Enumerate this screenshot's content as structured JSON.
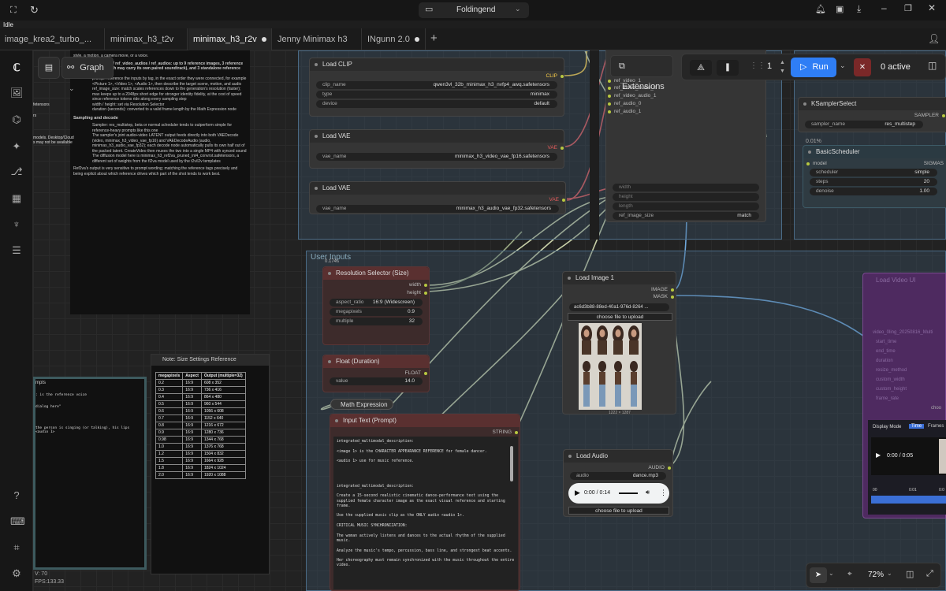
{
  "window": {
    "title": "Foldingend",
    "status": "Idle"
  },
  "tabs": [
    {
      "label": "image_krea2_turbo_..."
    },
    {
      "label": "minimax_h3_t2v"
    },
    {
      "label": "minimax_h3_r2v"
    },
    {
      "label": "Jenny Minimax h3"
    },
    {
      "label": "INgunn 2.0"
    }
  ],
  "toolbar": {
    "graph_label": "Graph",
    "extensions_label": "Extensions",
    "queue_count": "1",
    "run_label": "Run",
    "active_label": "0 active"
  },
  "bottom_right": {
    "zoom": "72%"
  },
  "stats": {
    "v": "V: 70",
    "fps": "FPS:133.33"
  },
  "doc": {
    "header": "About this workflow",
    "intro": "style, a motion, a camera move, or a voice.",
    "lines": [
      "ref_videos / ref_video_audios / ref_audios: up to 9 reference images, 3 reference videos (each may carry its own paired soundtrack), and 3 standalone reference audio clips",
      "prompt: reference the inputs by tag, in the exact order they were connected, for example <Picture 1>, <Video 1>, <Audio 1>, then describe the target scene, motion, and audio",
      "ref_image_size: match scales references down to the generation's resolution (faster); max keeps up to a 2048px short edge for stronger identity fidelity, at the cost of speed since reference tokens ride along every sampling step",
      "width / height: set via Resolution Selector",
      "duration (seconds): converted to a valid frame length by the Math Expression node"
    ],
    "section": "Sampling and decode",
    "sampling": [
      "Sampler: res_multistep, beta or normal scheduler tends to outperform simple for reference-heavy prompts like this one",
      "The sampler's joint audio+video LATENT output feeds directly into both VAEDecode (video, minimax_h3_video_vae_fp16) and VAEDecodeAudio (audio, minimax_h3_audio_vae_fp32); each decode node automatically pulls its own half out of the packed latent. CreateVideo then muxes the two into a single MP4 with synced sound",
      "The diffusion model here is minimax_h3_ref2va_pruned_int4_convrot.safetensors, a different set of weights from the fl2va model used by the t2v/i2v templates"
    ],
    "footer": "Ref2va's output is very sensitive to prompt wording; matching the reference tags precisely and being explicit about which reference drives which part of the shot tends to work best.",
    "side_frags": [
      "models. Desktop/Cloud",
      "s may not be available",
      "fetensors",
      "rs"
    ]
  },
  "mini_notes": {
    "title": "mpts",
    "lines": [
      ": is the reference voice",
      "dialog here\"",
      "the person is singing (or talking), his lips",
      "<audio 1>"
    ]
  },
  "nodes": {
    "load_clip": {
      "title": "Load CLIP",
      "out": "CLIP",
      "w": [
        [
          "clip_name",
          "qwen3vl_32b_minimax_h3_nvfp4_awq.safetensors"
        ],
        [
          "type",
          "minimax"
        ],
        [
          "device",
          "default"
        ]
      ]
    },
    "load_vae1": {
      "title": "Load VAE",
      "out": "VAE",
      "w": [
        [
          "vae_name",
          "minimax_h3_video_vae_fp16.safetensors"
        ]
      ]
    },
    "load_vae2": {
      "title": "Load VAE",
      "out": "VAE",
      "w": [
        [
          "vae_name",
          "minimax_h3_audio_vae_fp32.safetensors"
        ]
      ]
    },
    "refs": {
      "inputs": [
        "ref_video_1",
        "ref_video_audio_0",
        "ref_video_audio_1",
        "ref_audio_0",
        "ref_audio_1"
      ],
      "dim": [
        "width",
        "height",
        "length"
      ],
      "size": [
        "ref_image_size",
        "match"
      ]
    },
    "ksampler": {
      "title": "KSamplerSelect",
      "out": "SAMPLER",
      "w": [
        [
          "sampler_name",
          "res_multistep"
        ]
      ]
    },
    "percent": "0.01%",
    "scheduler": {
      "title": "BasicScheduler",
      "out": "SIGMAS",
      "in": "model",
      "w": [
        [
          "scheduler",
          "simple"
        ],
        [
          "steps",
          "20"
        ],
        [
          "denoise",
          "1.00"
        ]
      ]
    },
    "group_title": "User Inputs",
    "res": {
      "title": "Resolution Selector (Size)",
      "time": "0.174s",
      "outs": [
        "width",
        "height"
      ],
      "w": [
        [
          "aspect_ratio",
          "16:9 (Widescreen)"
        ],
        [
          "megapixels",
          "0.9"
        ],
        [
          "multiple",
          "32"
        ]
      ]
    },
    "float": {
      "title": "Float (Duration)",
      "out": "FLOAT",
      "w": [
        [
          "value",
          "14.0"
        ]
      ]
    },
    "math": {
      "title": "Math Expression"
    },
    "prompt": {
      "title": "Input Text (Prompt)",
      "out": "STRING",
      "text": "integrated_multimodal_description:\n\n<image 1> is the CHARACTER APPEARANCE REFERENCE for female dancer.\n\n<audio 1> use for music reference.\n\n\n\n\nintegrated_multimodal_description:\n\nCreate a 15-second realistic cinematic dance-performance text using the supplied female character image as the exact visual reference and starting frame.\n\nUse the supplied music clip as the ONLY audio <audio 1>.\n\nCRITICAL MUSIC SYNCHRONIZATION:\n\nThe woman actively listens and dances to the actual rhythm of the supplied music.\n\nAnalyze the music's tempo, percussion, bass line, and strongest beat accents.\n\nHer choreography must remain synchronized with the music throughout the entire video."
    },
    "load_image": {
      "title": "Load Image 1",
      "outs": [
        "IMAGE",
        "MASK"
      ],
      "file": "ac6d3b88-88ed-40a1-976d-8264 ...",
      "upload": "choose file to upload",
      "dims": "1222 × 1287"
    },
    "load_audio": {
      "title": "Load Audio",
      "out": "AUDIO",
      "file_label": "audio",
      "file": "dance.mp3",
      "time": "0:00 / 0:14",
      "upload": "choose file to upload"
    },
    "load_video": {
      "title": "Load Video UI",
      "ghost": [
        "video_0ling_20250816_Multi",
        "start_time",
        "end_time",
        "duration",
        "resize_method",
        "custom_width",
        "custom_height",
        "frame_rate"
      ],
      "choose": "choo",
      "display_mode": "Display Mode",
      "modes": [
        "Time",
        "Frames"
      ],
      "time": "0:00 / 0:05",
      "t0": "00",
      "t1": "0:01",
      "t2": "0:0"
    },
    "size_note": {
      "title": "Note: Size Settings Reference",
      "head": [
        "megapixels",
        "Aspect",
        "Output (multiple=32)"
      ],
      "rows": [
        [
          "0.2",
          "16:9",
          "608 x 352"
        ],
        [
          "0.3",
          "16:9",
          "736 x 416"
        ],
        [
          "0.4",
          "16:9",
          "864 x 480"
        ],
        [
          "0.5",
          "16:9",
          "960 x 544"
        ],
        [
          "0.6",
          "16:9",
          "1056 x 608"
        ],
        [
          "0.7",
          "16:9",
          "1152 x 640"
        ],
        [
          "0.8",
          "16:9",
          "1216 x 672"
        ],
        [
          "0.9",
          "16:9",
          "1280 x 736"
        ],
        [
          "0.98",
          "16:9",
          "1344 x 768"
        ],
        [
          "1.0",
          "16:9",
          "1376 x 768"
        ],
        [
          "1.2",
          "16:9",
          "1504 x 832"
        ],
        [
          "1.5",
          "16:9",
          "1664 x 928"
        ],
        [
          "1.8",
          "16:9",
          "1824 x 1024"
        ],
        [
          "2.0",
          "16:9",
          "1920 x 1088"
        ]
      ]
    }
  }
}
